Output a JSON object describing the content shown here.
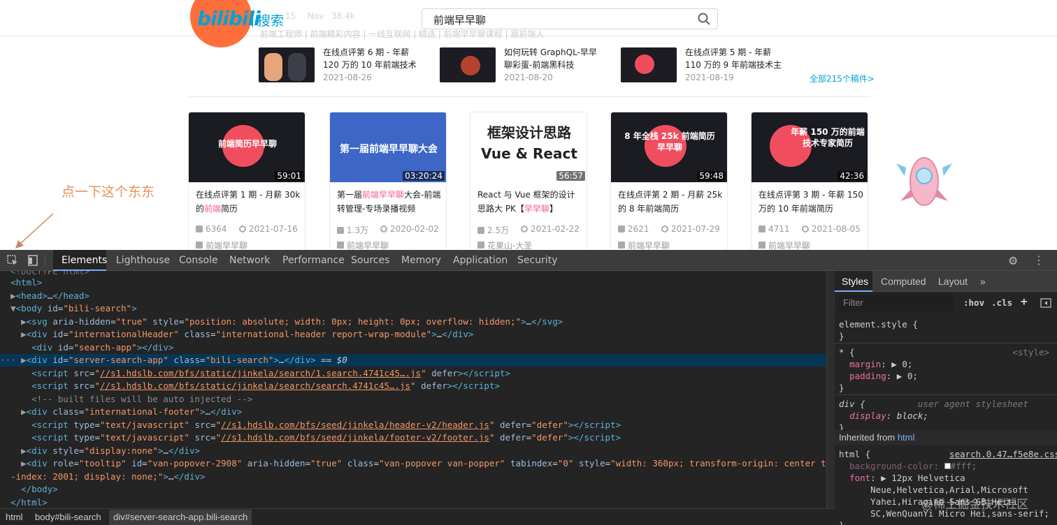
{
  "site": {
    "logo_text": "bilibili",
    "logo_search_text": "搜索",
    "search_query": "前端早早聊",
    "faint_top": [
      "15",
      "Nov",
      "38.4k"
    ],
    "faint_sub": "前端工程师 | 前端精彩内容 | 一线互联网 | 精选 | 前端早早聊课程 | 跟前端人",
    "recent_videos": [
      {
        "title": "在线点评第 6 期 - 年薪 120 万的 10 年前端技术",
        "date": "2021-08-26"
      },
      {
        "title": "如何玩转 GraphQL-早早聊彩蛋-前端黑科技",
        "date": "2021-08-20"
      },
      {
        "title": "在线点评第 5 期 - 年薪 110 万的 9 年前端技术主",
        "date": "2021-08-19"
      }
    ],
    "all_count_label": "全部215个稿件>",
    "cards": [
      {
        "thumb_caption": "前端简历早早聊",
        "duration": "59:01",
        "title_a": "在线点评第 1 期 - 月薪 30k 的",
        "title_hl": "前端",
        "title_b": "简历",
        "views": "6364",
        "date": "2021-07-16",
        "uploader": "前端早早聊"
      },
      {
        "thumb_caption": "第一届前端早早聊大会",
        "duration": "03:20:24",
        "title_a": "第一届",
        "title_hl": "前端早早聊",
        "title_b": "大会-前端转管理-专场录播视频",
        "views": "1.3万",
        "date": "2020-02-02",
        "uploader": "前端早早聊"
      },
      {
        "thumb_caption": "框架设计思路 Vue & React",
        "duration": "56:57",
        "title_a": "React 与 Vue 框架的设计思路大 PK【",
        "title_hl": "早早聊",
        "title_b": "】",
        "views": "2.5万",
        "date": "2021-02-22",
        "uploader": "花果山-大圣"
      },
      {
        "thumb_caption": "8 年全栈 25k 前端简历早早聊",
        "duration": "59:48",
        "title_a": "在线点评第 2 期 - 月薪 25k 的 8 年前端简历",
        "title_hl": "",
        "title_b": "",
        "views": "2621",
        "date": "2021-07-29",
        "uploader": "前端早早聊"
      },
      {
        "thumb_caption": "年薪 150 万的前端技术专家简历",
        "duration": "42:36",
        "title_a": "在线点评第 3 期 - 年薪 150 万的 10 年前端简历",
        "title_hl": "",
        "title_b": "",
        "views": "4711",
        "date": "2021-08-05",
        "uploader": "前端早早聊"
      }
    ],
    "annotation": "点一下这个东东"
  },
  "devtools": {
    "tabs": [
      "Elements",
      "Lighthouse",
      "Console",
      "Network",
      "Performance",
      "Sources",
      "Memory",
      "Application",
      "Security"
    ],
    "active_tab": "Elements",
    "side_tabs": [
      "Styles",
      "Computed",
      "Layout",
      "»"
    ],
    "filter_placeholder": "Filter",
    "hov_label": ":hov",
    "cls_label": ".cls",
    "inherited_label": "Inherited from",
    "inherited_from": "html",
    "breadcrumbs": [
      "html",
      "body#bili-search",
      "div#server-search-app.bili-search"
    ]
  },
  "watermark": "@稀土掘金技术社区",
  "colors": {
    "accent": "#00a1d6",
    "pink": "#f25d8e",
    "selection": "#073655",
    "devtools_bg": "#242424"
  }
}
